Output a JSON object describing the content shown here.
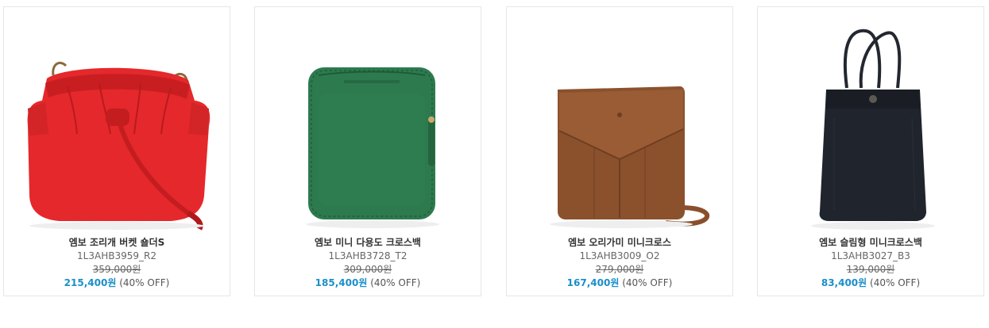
{
  "products": [
    {
      "name": "엠보 조리개 버켓 숄더S",
      "code": "1L3AHB3959_R2",
      "original_price": "359,000원",
      "sale_price": "215,400원",
      "discount": "(40% OFF)",
      "image": "red-bucket-bag",
      "color": "#e02a2a"
    },
    {
      "name": "엠보 미니 다용도 크로스백",
      "code": "1L3AHB3728_T2",
      "original_price": "309,000원",
      "sale_price": "185,400원",
      "discount": "(40% OFF)",
      "image": "green-crossbody-bag",
      "color": "#2c7a4e"
    },
    {
      "name": "엠보 오리가미 미니크로스",
      "code": "1L3AHB3009_O2",
      "original_price": "279,000원",
      "sale_price": "167,400원",
      "discount": "(40% OFF)",
      "image": "brown-origami-crossbody-bag",
      "color": "#8a4f2c"
    },
    {
      "name": "엠보 슬림형 미니크로스백",
      "code": "1L3AHB3027_B3",
      "original_price": "139,000원",
      "sale_price": "83,400원",
      "discount": "(40% OFF)",
      "image": "black-slim-tote-bag",
      "color": "#1f232b"
    }
  ],
  "colors": {
    "sale_price": "#1a8fc9",
    "card_border": "#e6e6e6"
  }
}
